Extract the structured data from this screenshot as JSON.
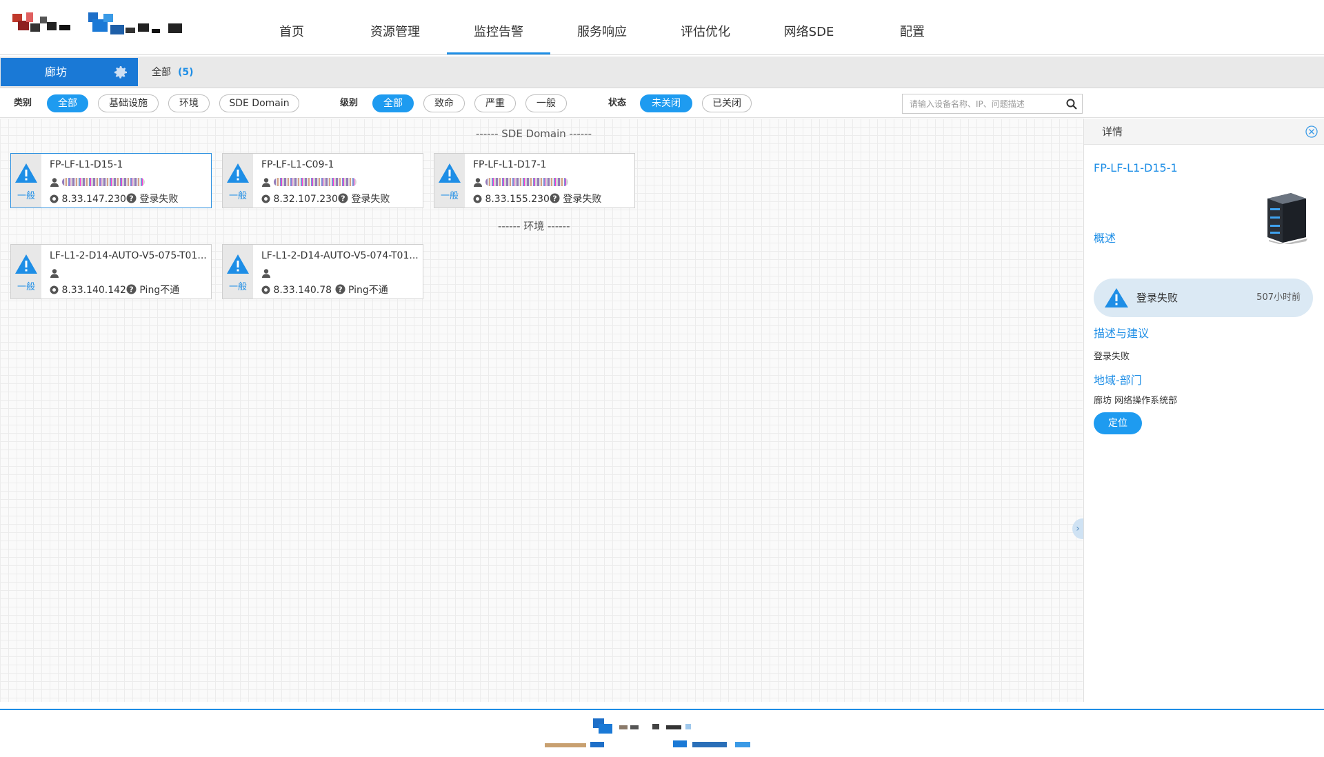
{
  "nav": {
    "items": [
      {
        "label": "首页",
        "active": false
      },
      {
        "label": "资源管理",
        "active": false
      },
      {
        "label": "监控告警",
        "active": true
      },
      {
        "label": "服务响应",
        "active": false
      },
      {
        "label": "评估优化",
        "active": false
      },
      {
        "label": "网络SDE",
        "active": false
      },
      {
        "label": "配置",
        "active": false
      }
    ]
  },
  "region": {
    "name": "廊坊",
    "all_label": "全部",
    "count": "(5)"
  },
  "filters": {
    "category": {
      "label": "类别",
      "options": [
        "全部",
        "基础设施",
        "环境",
        "SDE Domain"
      ],
      "selected": "全部"
    },
    "level": {
      "label": "级别",
      "options": [
        "全部",
        "致命",
        "严重",
        "一般"
      ],
      "selected": "全部"
    },
    "status": {
      "label": "状态",
      "options": [
        "未关闭",
        "已关闭"
      ],
      "selected": "未关闭"
    },
    "search_placeholder": "请输入设备名称、IP、问题描述"
  },
  "groups": [
    {
      "title": "------ SDE Domain ------",
      "cards": [
        {
          "name": "FP-LF-L1-D15-1",
          "level": "一般",
          "ip": "8.33.147.230",
          "issue": "登录失败",
          "selected": true
        },
        {
          "name": "FP-LF-L1-C09-1",
          "level": "一般",
          "ip": "8.32.107.230",
          "issue": "登录失败",
          "selected": false
        },
        {
          "name": "FP-LF-L1-D17-1",
          "level": "一般",
          "ip": "8.33.155.230",
          "issue": "登录失败",
          "selected": false
        }
      ]
    },
    {
      "title": "------ 环境 ------",
      "cards": [
        {
          "name": "LF-L1-2-D14-AUTO-V5-075-T01...",
          "level": "一般",
          "ip": "8.33.140.142",
          "issue": "Ping不通",
          "selected": false
        },
        {
          "name": "LF-L1-2-D14-AUTO-V5-074-T01...",
          "level": "一般",
          "ip": "8.33.140.78",
          "issue": "Ping不通",
          "selected": false
        }
      ]
    }
  ],
  "detail": {
    "title": "详情",
    "device_name": "FP-LF-L1-D15-1",
    "overview_label": "概述",
    "alarm_text": "登录失败",
    "alarm_time": "507小时前",
    "desc_label": "描述与建议",
    "desc_text": "登录失败",
    "region_label": "地域-部门",
    "region_text": "廊坊 网络操作系统部",
    "locate_label": "定位"
  },
  "colors": {
    "accent": "#1e8ee6",
    "chip_active": "#1e9bf0",
    "region_tab": "#1a79d6",
    "warning_icon": "#1e8ee6"
  }
}
